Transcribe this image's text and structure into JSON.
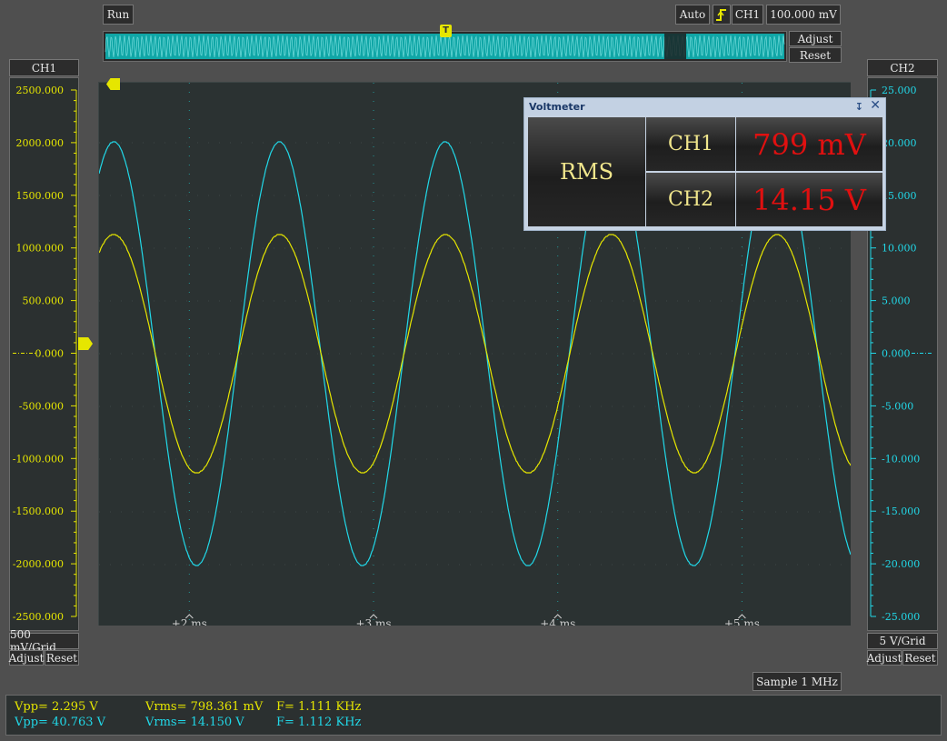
{
  "toolbar": {
    "run_label": "Run",
    "trigger_mode": "Auto",
    "trigger_channel": "CH1",
    "trigger_level": "100.000 mV",
    "adjust_label": "Adjust",
    "reset_label": "Reset",
    "trigger_marker": "T"
  },
  "left_axis": {
    "title": "CH1",
    "ticks": [
      "2500.000",
      "2000.000",
      "1500.000",
      "1000.000",
      "500.000",
      "0.000",
      "-500.000",
      "-1000.000",
      "-1500.000",
      "-2000.000",
      "-2500.000"
    ],
    "scale": "500 mV/Grid",
    "adjust_label": "Adjust",
    "reset_label": "Reset",
    "color": "#e6e600"
  },
  "right_axis": {
    "title": "CH2",
    "ticks": [
      "25.000",
      "20.000",
      "15.000",
      "10.000",
      "5.000",
      "0.000",
      "-5.000",
      "-10.000",
      "-15.000",
      "-20.000",
      "-25.000"
    ],
    "scale": "5 V/Grid",
    "adjust_label": "Adjust",
    "reset_label": "Reset",
    "color": "#21d8e8"
  },
  "time_axis": {
    "labels": [
      "+2 ms",
      "+3 ms",
      "+4 ms",
      "+5 ms"
    ]
  },
  "voltmeter": {
    "title": "Voltmeter",
    "pin_icon": "pin-icon",
    "close_icon": "close-icon",
    "mode": "RMS",
    "ch1_label": "CH1",
    "ch1_value": "799 mV",
    "ch2_label": "CH2",
    "ch2_value": "14.15 V"
  },
  "sample_rate": "Sample 1 MHz",
  "measurements": {
    "ch1": {
      "vpp": "Vpp= 2.295 V",
      "vrms": "Vrms= 798.361 mV",
      "freq": "F= 1.111 KHz"
    },
    "ch2": {
      "vpp": "Vpp= 40.763 V",
      "vrms": "Vrms= 14.150 V",
      "freq": "F= 1.112 KHz"
    }
  },
  "chart_data": {
    "type": "line",
    "xlabel": "",
    "ylabel": "",
    "x_unit": "ms",
    "xlim": [
      1.51,
      5.59
    ],
    "series": [
      {
        "name": "CH1",
        "axis": "left",
        "unit": "mV",
        "amplitude": 1130,
        "offset": 0,
        "frequency_khz": 1.111,
        "phase_peak_ms": 1.59,
        "color": "#e6e600"
      },
      {
        "name": "CH2",
        "axis": "right",
        "unit": "V",
        "amplitude": 20.1,
        "offset": 0,
        "frequency_khz": 1.112,
        "phase_peak_ms": 1.59,
        "color": "#21d8e8"
      }
    ],
    "left_ylim": [
      -2500,
      2500
    ],
    "right_ylim": [
      -25,
      25
    ],
    "grid": true
  }
}
